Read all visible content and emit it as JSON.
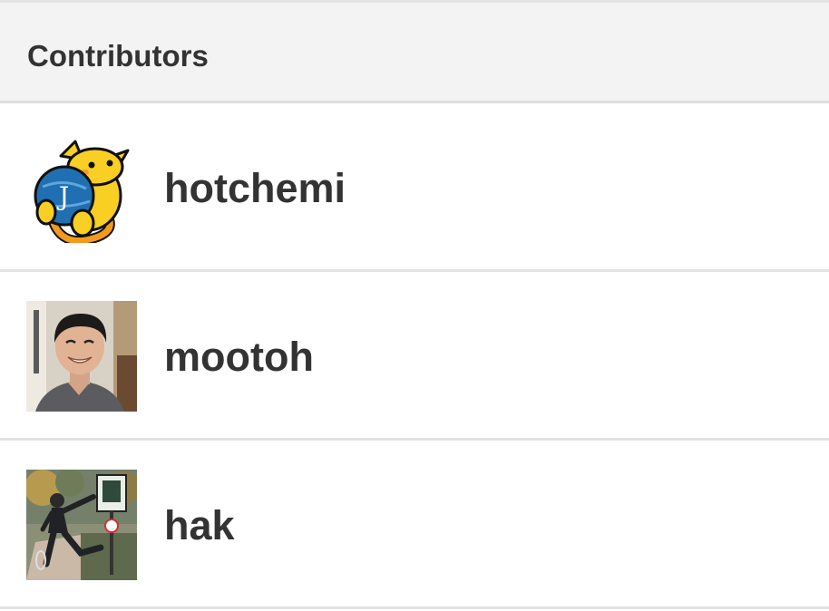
{
  "header": {
    "title": "Contributors"
  },
  "contributors": [
    {
      "name": "hotchemi",
      "avatar": "wapuu-mascot-icon"
    },
    {
      "name": "mootoh",
      "avatar": "person-photo-avatar"
    },
    {
      "name": "hak",
      "avatar": "person-outdoor-photo-avatar"
    }
  ]
}
